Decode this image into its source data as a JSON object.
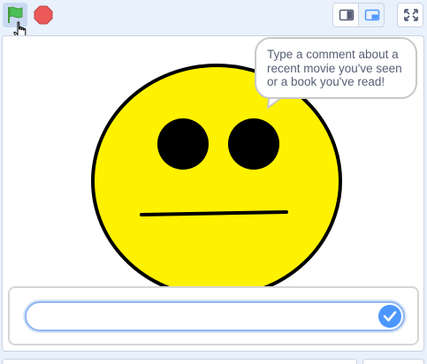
{
  "toolbar": {
    "green_flag_icon": "green-flag-icon",
    "stop_icon": "stop-icon",
    "small_stage_icon": "small-stage-icon",
    "normal_stage_icon": "normal-stage-icon",
    "fullscreen_icon": "fullscreen-icon"
  },
  "stage": {
    "sprite": "neutral-face",
    "speech_bubble": {
      "text": "Type a comment about a recent movie you've seen or a book you've read!"
    },
    "ask_prompt": {
      "input_value": "",
      "submit_icon": "checkmark-icon"
    }
  },
  "colors": {
    "face_fill": "#fff200",
    "accent": "#4c97ff",
    "flag": "#4cbf56",
    "stop": "#ec5959",
    "background": "#e9f1fc"
  }
}
